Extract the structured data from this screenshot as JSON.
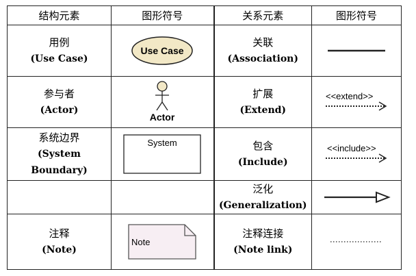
{
  "headers": [
    "结构元素",
    "图形符号",
    "关系元素",
    "图形符号"
  ],
  "rows": [
    {
      "struct_cn": "用例",
      "struct_en": "(Use Case)",
      "struct_symbol_text": "Use Case",
      "rel_cn": "关联",
      "rel_en": "(Association)"
    },
    {
      "struct_cn": "参与者",
      "struct_en": "(Actor)",
      "struct_symbol_text": "Actor",
      "rel_cn": "扩展",
      "rel_en": "(Extend)",
      "rel_symbol_text": "<<extend>>"
    },
    {
      "struct_cn": "系统边界",
      "struct_en_1": "(System",
      "struct_en_2": "Boundary)",
      "struct_symbol_text": "System",
      "rel_cn": "包含",
      "rel_en": "(Include)",
      "rel_symbol_text": "<<include>>"
    },
    {
      "rel_cn": "泛化",
      "rel_en": "(Generalization)"
    },
    {
      "struct_cn": "注释",
      "struct_en": "(Note)",
      "struct_symbol_text": "Note",
      "rel_cn": "注释连接",
      "rel_en": "(Note link)"
    }
  ],
  "colors": {
    "usecase_fill": "#f2e8c6",
    "note_fill": "#f7eef3",
    "line": "#222222"
  }
}
